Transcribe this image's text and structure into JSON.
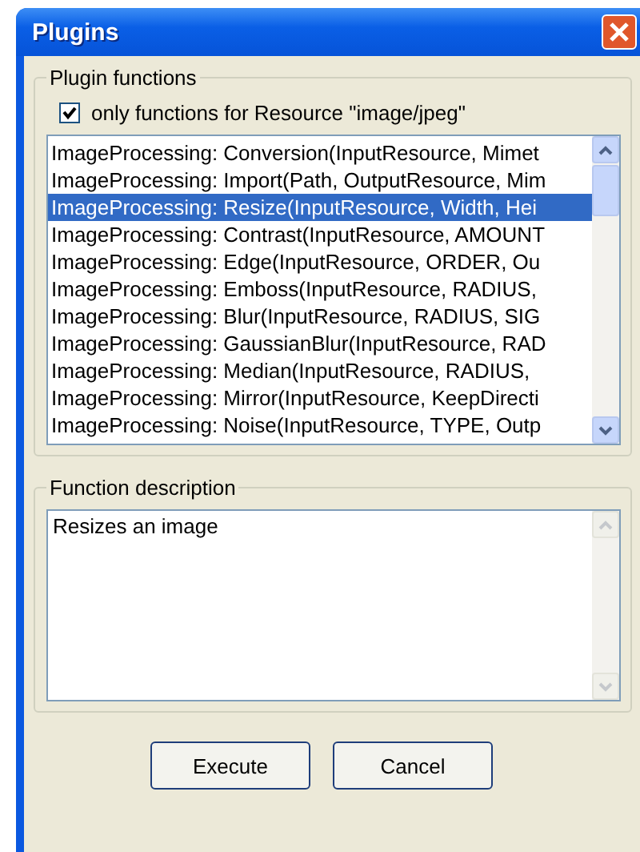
{
  "window": {
    "title": "Plugins"
  },
  "functions_group": {
    "legend": "Plugin functions",
    "filter": {
      "label": "only functions for Resource \"image/jpeg\"",
      "checked": true
    },
    "items": [
      {
        "label": "ImageProcessing: Conversion(InputResource, Mimet",
        "selected": false
      },
      {
        "label": "ImageProcessing: Import(Path, OutputResource, Mim",
        "selected": false
      },
      {
        "label": "ImageProcessing: Resize(InputResource, Width, Hei",
        "selected": true
      },
      {
        "label": "ImageProcessing: Contrast(InputResource, AMOUNT",
        "selected": false
      },
      {
        "label": "ImageProcessing: Edge(InputResource, ORDER, Ou",
        "selected": false
      },
      {
        "label": "ImageProcessing: Emboss(InputResource, RADIUS,",
        "selected": false
      },
      {
        "label": "ImageProcessing: Blur(InputResource, RADIUS, SIG",
        "selected": false
      },
      {
        "label": "ImageProcessing: GaussianBlur(InputResource, RAD",
        "selected": false
      },
      {
        "label": "ImageProcessing: Median(InputResource, RADIUS,",
        "selected": false
      },
      {
        "label": "ImageProcessing: Mirror(InputResource, KeepDirecti",
        "selected": false
      },
      {
        "label": "ImageProcessing: Noise(InputResource, TYPE, Outp",
        "selected": false
      }
    ]
  },
  "description_group": {
    "legend": "Function description",
    "text": "Resizes an image"
  },
  "buttons": [
    "Execute",
    "Cancel"
  ]
}
